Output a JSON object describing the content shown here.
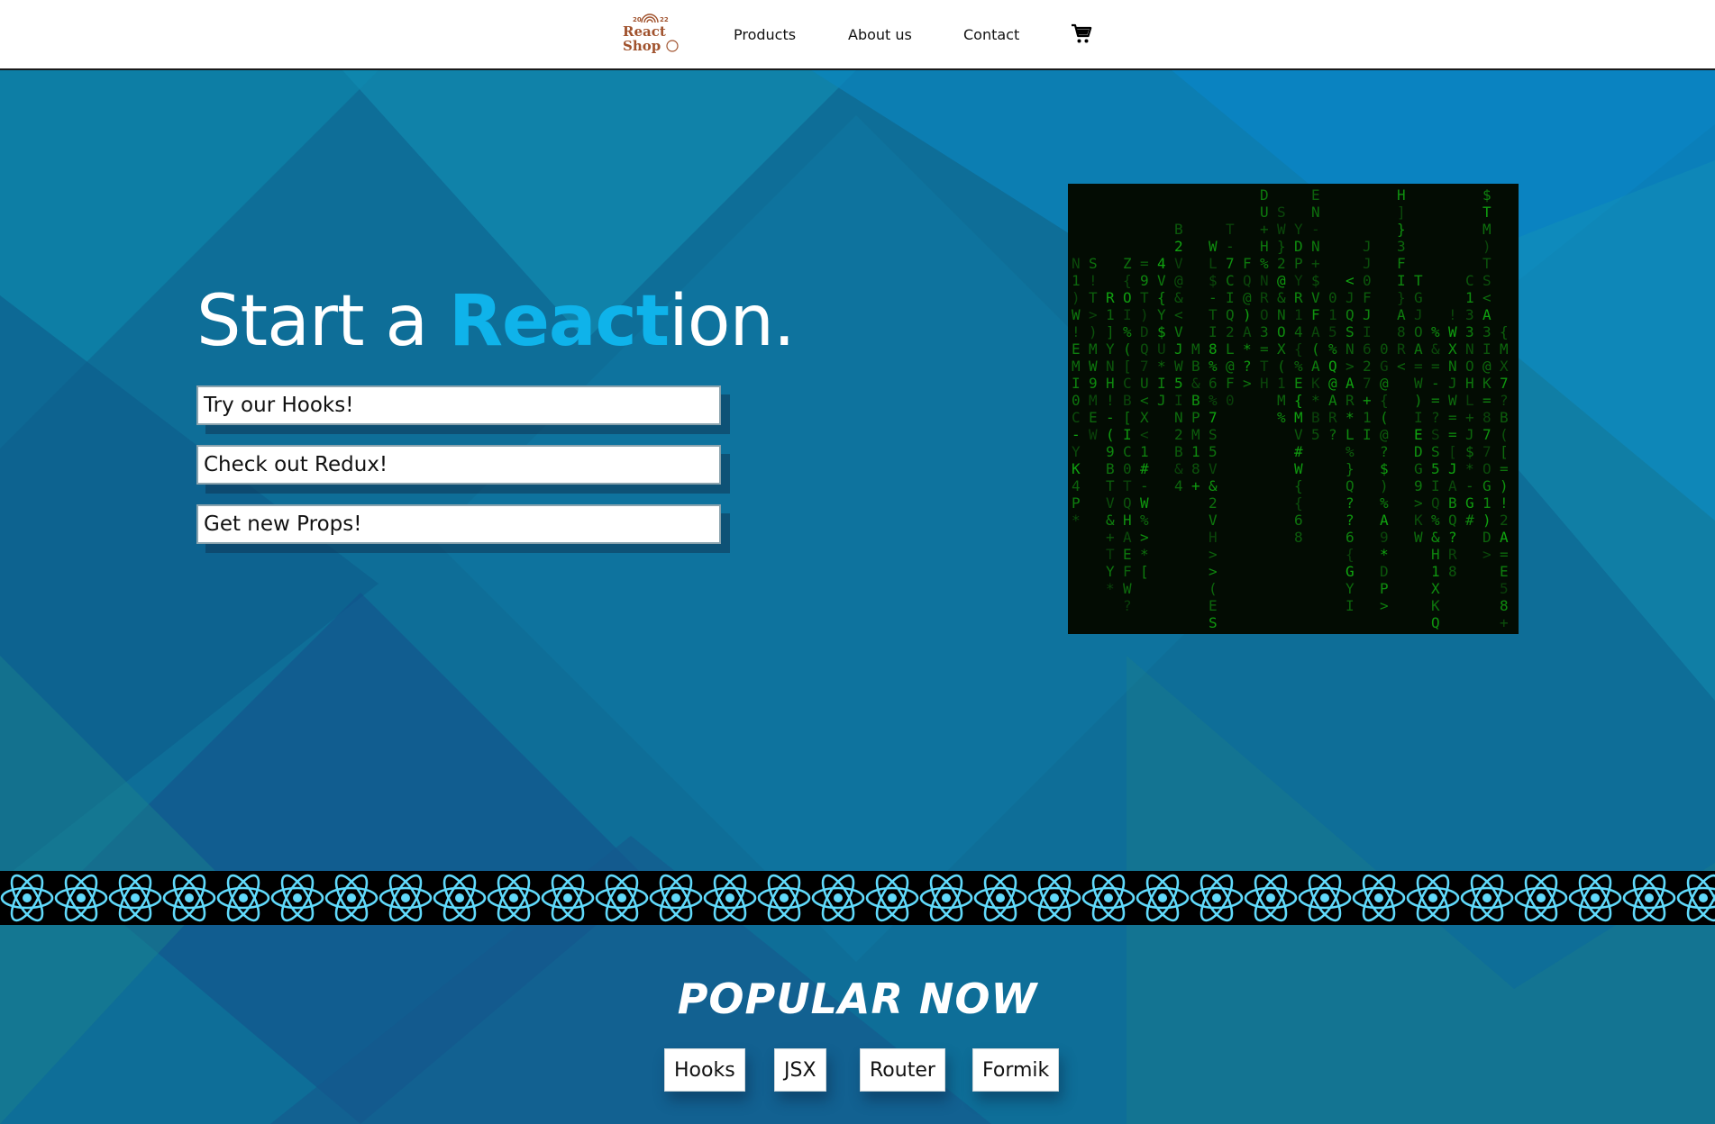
{
  "nav": {
    "logo": {
      "year_left": "20",
      "year_right": "22",
      "line1": "React",
      "line2": "Shop"
    },
    "links": [
      "Products",
      "About us",
      "Contact"
    ],
    "cart_icon": "cart-icon"
  },
  "hero": {
    "title_start": "Start a ",
    "title_highlight": "React",
    "title_end": "ion.",
    "buttons": [
      "Try our Hooks!",
      "Check out Redux!",
      "Get new Props!"
    ],
    "accent": "#0fb3ea"
  },
  "strip": {
    "icon": "react-atom-icon",
    "color": "#61dafb"
  },
  "popular": {
    "title": "POPULAR NOW",
    "tags": [
      "Hooks",
      "JSX",
      "Router",
      "Formik"
    ]
  }
}
